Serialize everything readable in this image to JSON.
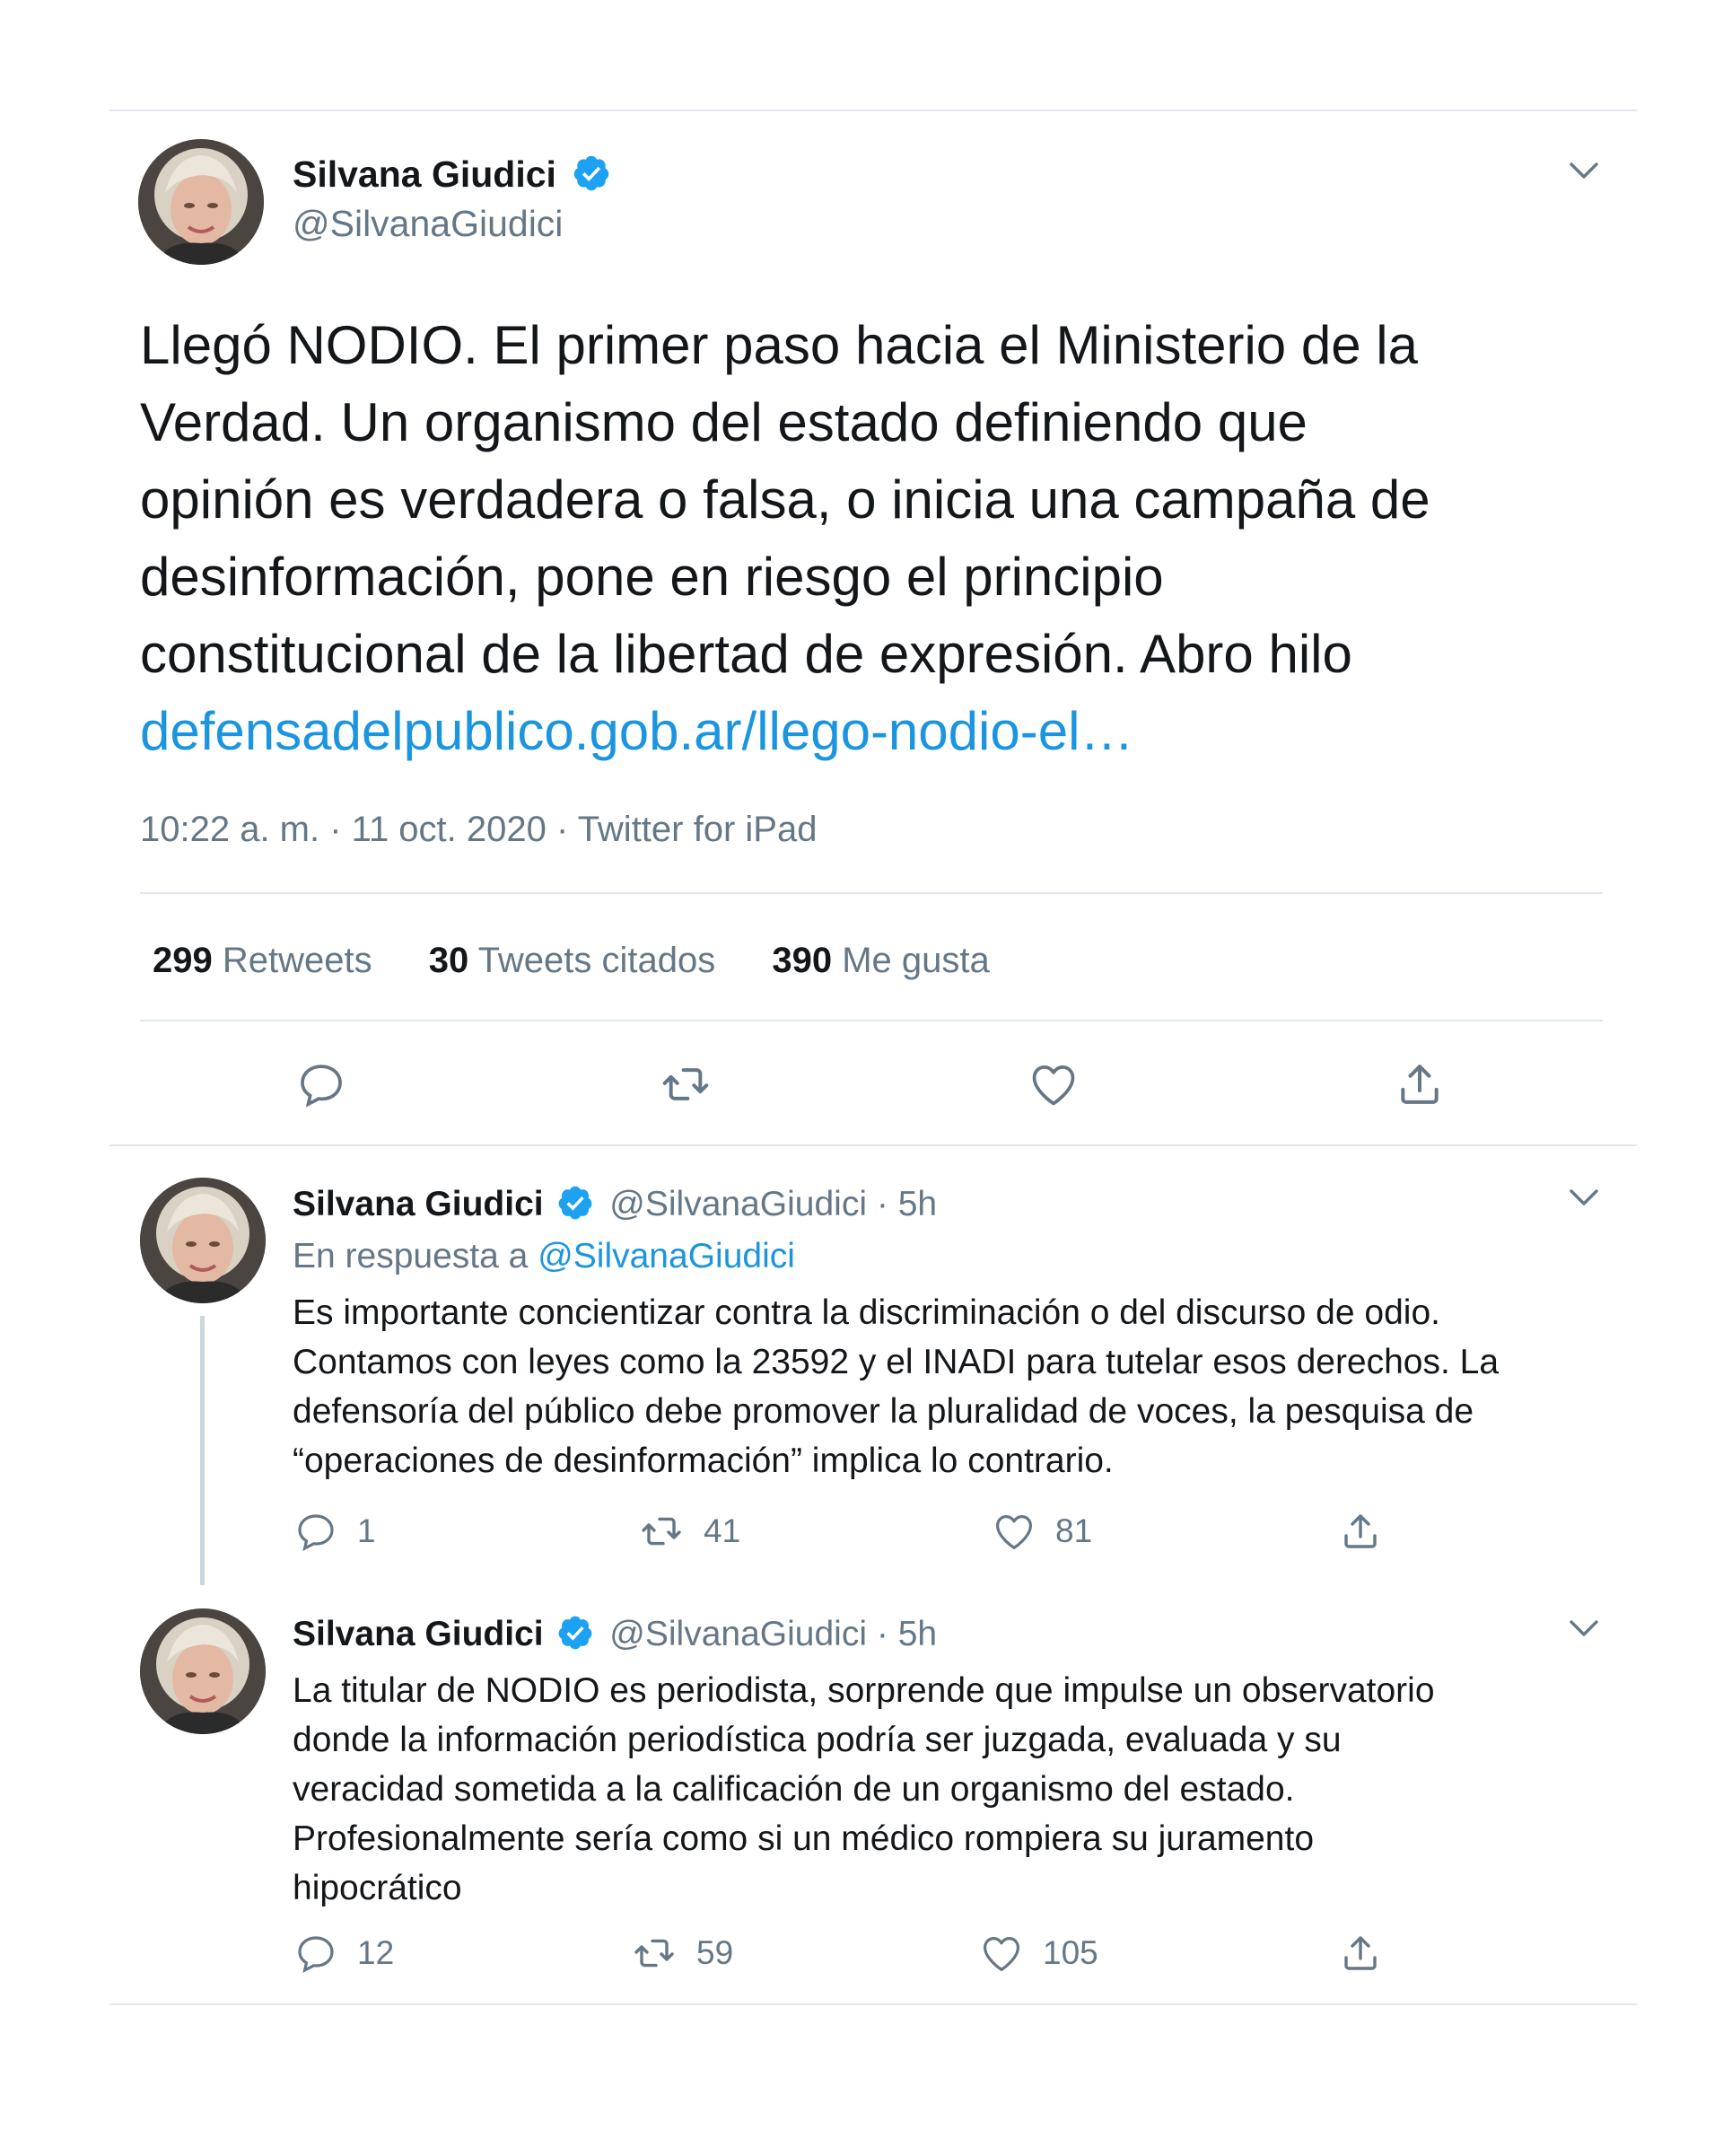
{
  "colors": {
    "text": "#14171a",
    "muted": "#657786",
    "link": "#1b95e0",
    "divider": "#e1e8ed",
    "verified": "#1da1f2"
  },
  "main_tweet": {
    "author": {
      "name": "Silvana Giudici",
      "handle": "@SilvanaGiudici",
      "verified": true
    },
    "text_lines": [
      "Llegó NODIO. El primer paso hacia el Ministerio de la",
      "Verdad. Un organismo del estado definiendo que",
      "opinión es verdadera o falsa, o inicia una campaña de",
      "desinformación, pone en riesgo el principio",
      "constitucional de la libertad de expresión. Abro hilo"
    ],
    "link": "defensadelpublico.gob.ar/llego-nodio-el…",
    "meta": "10:22 a. m. · 11 oct. 2020 · Twitter for iPad",
    "stats": {
      "retweets_count": "299",
      "retweets_label": "Retweets",
      "quotes_count": "30",
      "quotes_label": "Tweets citados",
      "likes_count": "390",
      "likes_label": "Me gusta"
    },
    "actions": [
      "reply-icon",
      "retweet-icon",
      "like-icon",
      "share-icon"
    ]
  },
  "replies": [
    {
      "author": {
        "name": "Silvana Giudici",
        "handle": "@SilvanaGiudici",
        "dot": "·",
        "time": "5h",
        "verified": true
      },
      "reply_to_label": "En respuesta a",
      "reply_to_handle": "@SilvanaGiudici",
      "text_lines": [
        "Es importante concientizar contra la discriminación o del discurso de odio.",
        "Contamos con leyes como la 23592 y el INADI para tutelar esos derechos. La",
        "defensoría del público debe promover la pluralidad de voces, la pesquisa de",
        "“operaciones de desinformación” implica lo contrario."
      ],
      "counts": {
        "replies": "1",
        "retweets": "41",
        "likes": "81"
      }
    },
    {
      "author": {
        "name": "Silvana Giudici",
        "handle": "@SilvanaGiudici",
        "dot": "·",
        "time": "5h",
        "verified": true
      },
      "text_lines": [
        "La titular de NODIO es periodista, sorprende que impulse un observatorio",
        "donde la información periodística podría ser juzgada, evaluada y su",
        "veracidad sometida a la calificación de un organismo del estado.",
        "Profesionalmente sería como si un médico rompiera su juramento",
        "hipocrático"
      ],
      "counts": {
        "replies": "12",
        "retweets": "59",
        "likes": "105"
      }
    }
  ]
}
